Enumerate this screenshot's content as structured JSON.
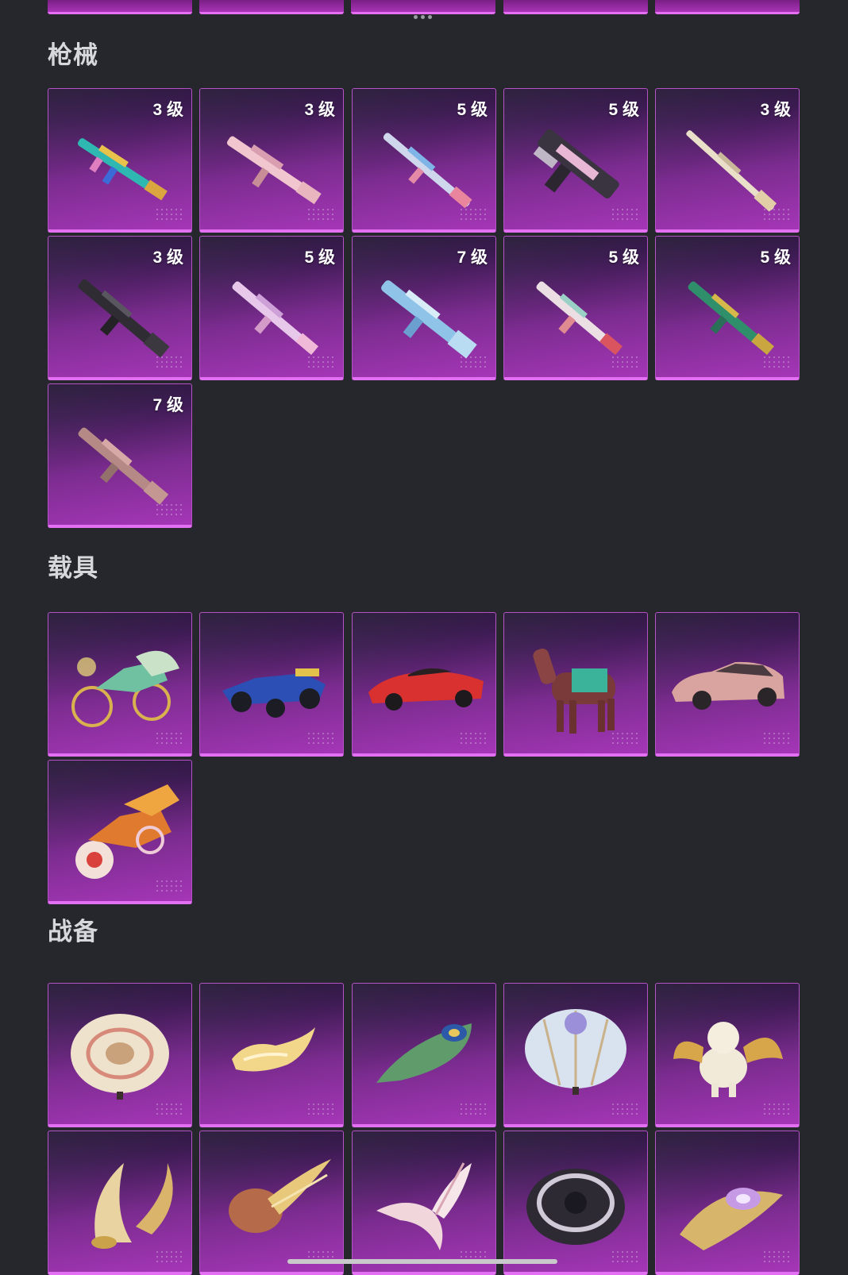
{
  "sections": {
    "guns": {
      "title": "枪械",
      "levels": [
        "3 级",
        "3 级",
        "5 级",
        "5 级",
        "3 级",
        "3 级",
        "5 级",
        "7 级",
        "5 级",
        "5 级",
        "7 级"
      ]
    },
    "vehicles": {
      "title": "载具"
    },
    "gear": {
      "title": "战备"
    }
  },
  "icons": {
    "guns": [
      "rifle-teal-icon",
      "rifle-pink-icon",
      "rifle-blue-pink-icon",
      "smg-black-pink-icon",
      "rifle-cream-icon",
      "rifle-black-icon",
      "rifle-lilac-icon",
      "rifle-blue-icon",
      "rifle-white-red-icon",
      "rifle-green-icon",
      "rifle-tan-icon"
    ],
    "vehicles": [
      "motorbike-gold-icon",
      "race-car-blue-icon",
      "sports-car-red-icon",
      "horse-mount-icon",
      "sedan-pink-icon",
      "motorbike-orange-icon"
    ],
    "gear": [
      "parachute-cream-icon",
      "glider-gold-icon",
      "glider-peacock-icon",
      "parachute-blue-icon",
      "pet-dragon-icon",
      "glider-wing-gold-icon",
      "glider-comet-icon",
      "glider-feather-icon",
      "parachute-black-icon",
      "glider-purple-icon"
    ]
  },
  "colors": {
    "background": "#25272d",
    "card_accent": "#e36ff2",
    "section_title": "#d7d8db"
  }
}
